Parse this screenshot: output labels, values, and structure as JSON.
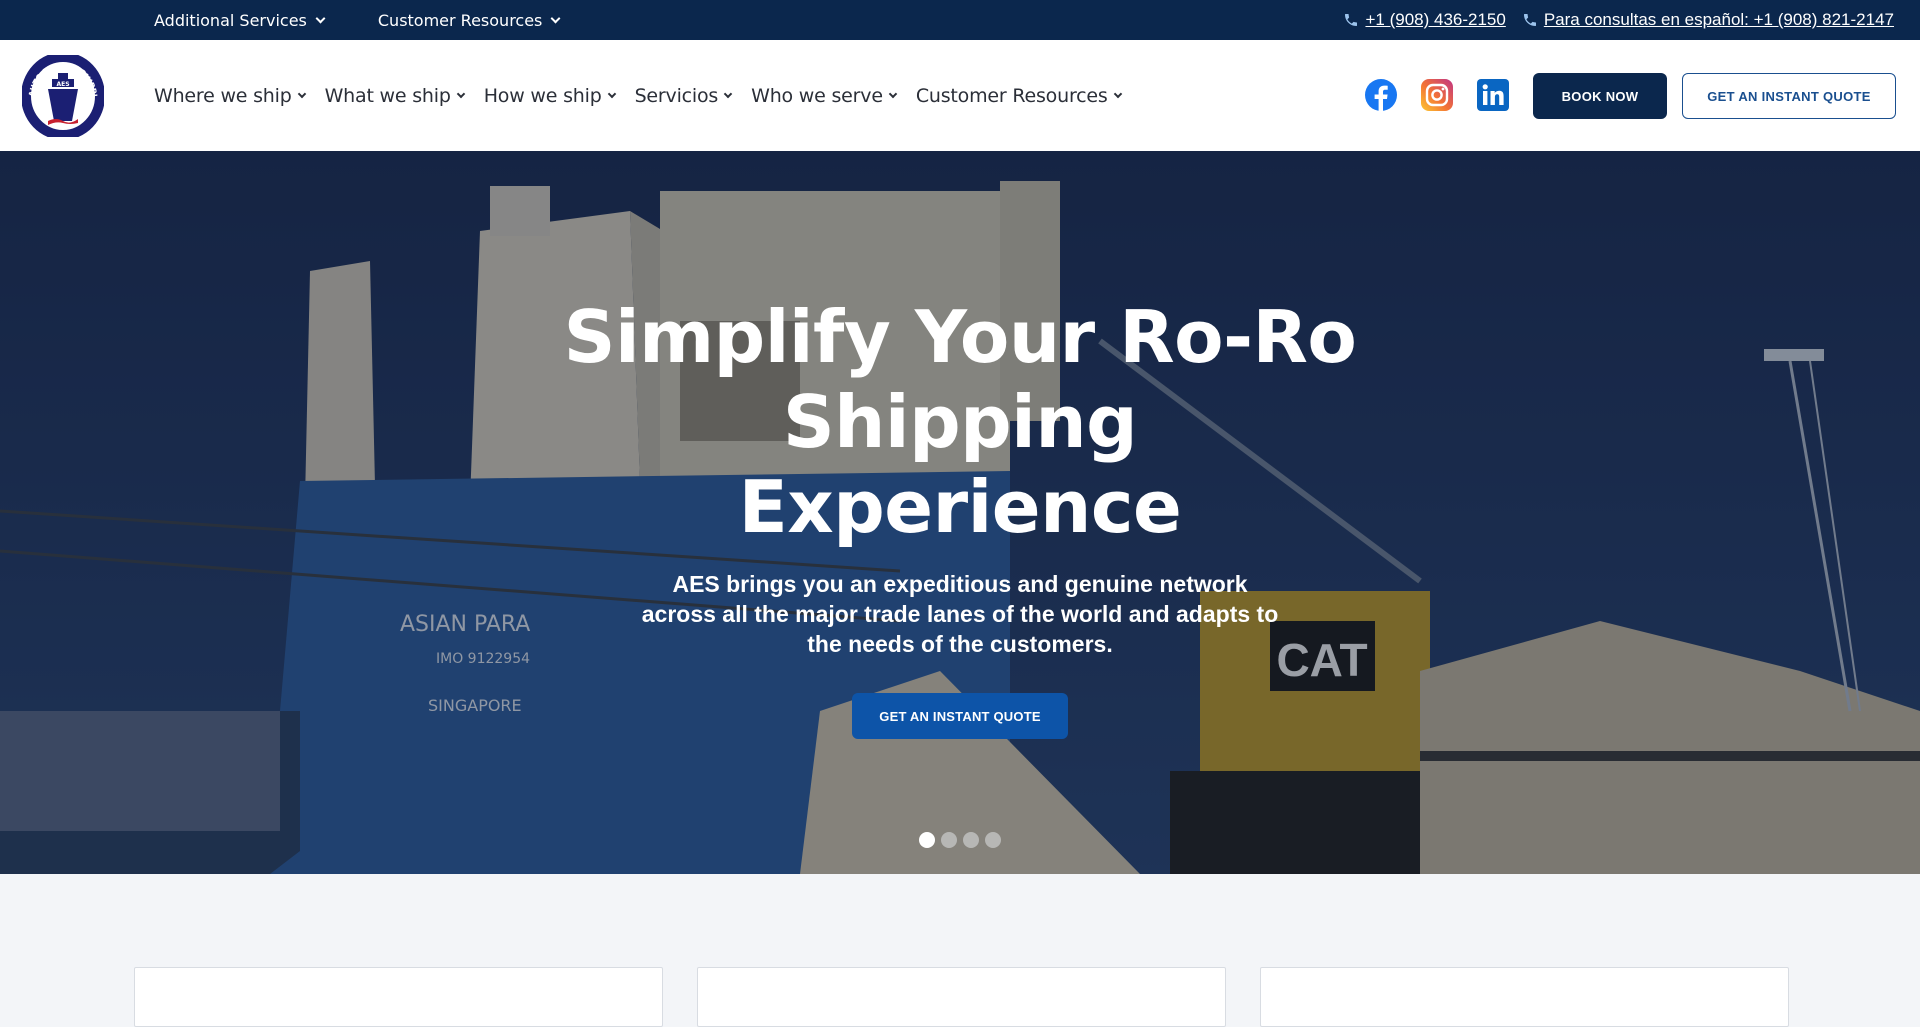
{
  "topbar": {
    "menus": [
      {
        "label": "Additional Services"
      },
      {
        "label": "Customer Resources"
      }
    ],
    "phones": [
      {
        "label": "+1 (908) 436-2150",
        "icon": "phone-icon"
      },
      {
        "label": "Para consultas en español: +1 (908) 821-2147",
        "icon": "phone-icon"
      }
    ]
  },
  "logo": {
    "alt": "Auto Export Shipping Inc.",
    "ring_text": "AUTO EXPORT SHIPPING INC.",
    "badge": "AES"
  },
  "nav": {
    "items": [
      {
        "label": "Where we ship"
      },
      {
        "label": "What we ship"
      },
      {
        "label": "How we ship"
      },
      {
        "label": "Servicios"
      },
      {
        "label": "Who we serve"
      },
      {
        "label": "Customer Resources"
      }
    ],
    "social": [
      {
        "name": "facebook-icon",
        "color": "#1877f2"
      },
      {
        "name": "instagram-icon",
        "color": "#e1306c"
      },
      {
        "name": "linkedin-icon",
        "color": "#0a66c2"
      }
    ],
    "book_label": "BOOK NOW",
    "quote_label": "GET AN INSTANT QUOTE"
  },
  "hero": {
    "title": "Simplify Your Ro-Ro Shipping Experience",
    "subtitle": "AES brings you an expeditious and genuine network across all the major trade lanes of the world and adapts to the needs of the customers.",
    "cta_label": "GET AN INSTANT QUOTE",
    "slides_total": 4,
    "active_slide": 1,
    "image_text": {
      "ship_name": "ASIAN PARA",
      "imo": "IMO 9122954",
      "port": "SINGAPORE",
      "brand": "CAT"
    }
  },
  "colors": {
    "navy": "#0b274d",
    "accent_blue": "#0d54a8",
    "quote_outline": "#1a4f8f",
    "page_bg": "#f3f5f8"
  }
}
